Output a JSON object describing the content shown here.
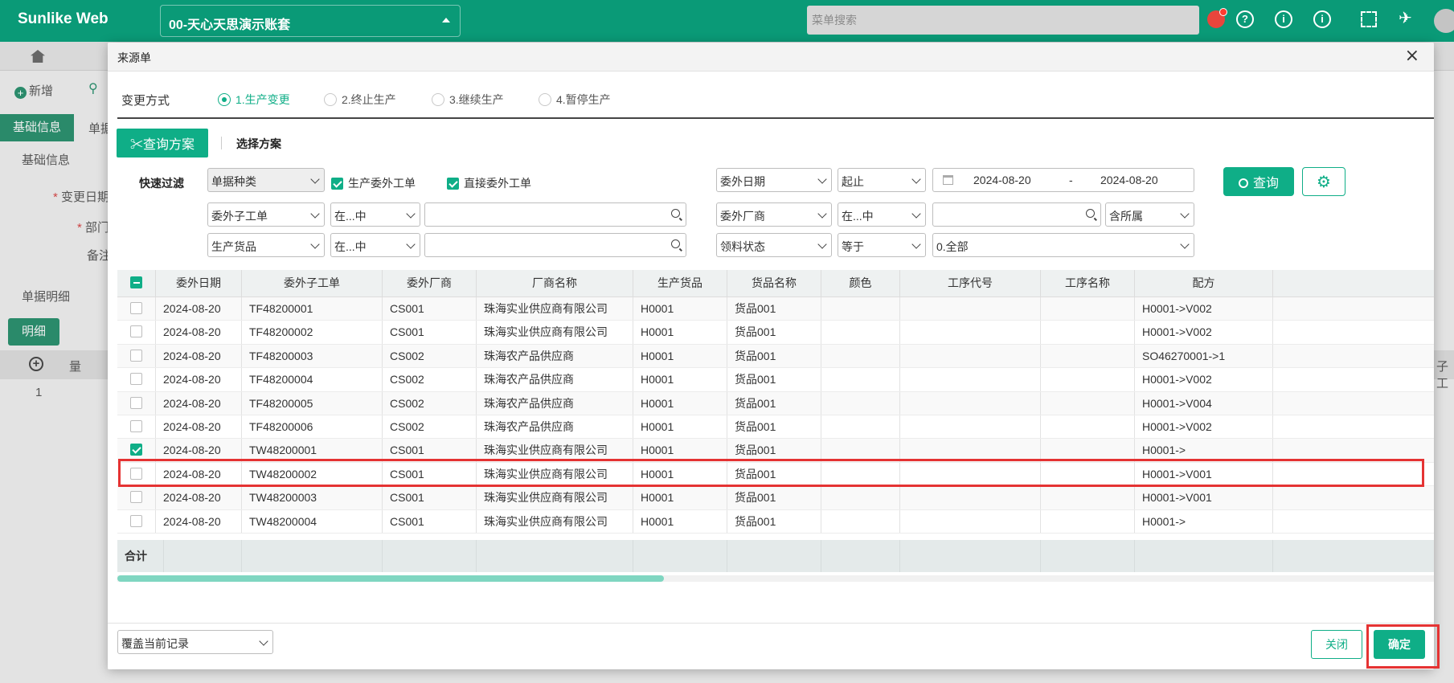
{
  "app": {
    "brand": "Sunlike Web",
    "account": "00-天心天思演示账套",
    "menu_search_placeholder": "菜单搜索"
  },
  "background": {
    "toolbar_new": "新增",
    "tab_basic": "基础信息",
    "tab_doc": "单据",
    "section_basic": "基础信息",
    "field_change_date": "变更日期",
    "field_dept": "部门",
    "field_note": "备注",
    "section_detail": "单据明细",
    "btn_detail": "明细",
    "col_qty": "量",
    "row_no": "1",
    "col_partial": "子工"
  },
  "modal": {
    "title": "来源单",
    "change_label": "变更方式",
    "radios": [
      {
        "label": "1.生产变更",
        "selected": true
      },
      {
        "label": "2.终止生产",
        "selected": false
      },
      {
        "label": "3.继续生产",
        "selected": false
      },
      {
        "label": "4.暂停生产",
        "selected": false
      }
    ],
    "scheme_button": "查询方案",
    "select_scheme": "选择方案",
    "quick_filter": "快速过滤",
    "filters": {
      "doc_type": "单据种类",
      "cb_prod_sub": "生产委外工单",
      "cb_direct_sub": "直接委外工单",
      "sub_date": "委外日期",
      "date_mode": "起止",
      "date_from": "2024-08-20",
      "date_sep": "-",
      "date_to": "2024-08-20",
      "sub_order": "委外子工单",
      "op_in1": "在...中",
      "vendor": "委外厂商",
      "op_in2": "在...中",
      "include_sub": "含所属",
      "prod_goods": "生产货品",
      "op_in3": "在...中",
      "material_status": "领料状态",
      "op_eq": "等于",
      "status_value": "0.全部"
    },
    "query_button": "查询",
    "table": {
      "columns": [
        "委外日期",
        "委外子工单",
        "委外厂商",
        "厂商名称",
        "生产货品",
        "货品名称",
        "颜色",
        "工序代号",
        "工序名称",
        "配方"
      ],
      "rows": [
        {
          "checked": false,
          "date": "2024-08-20",
          "order": "TF48200001",
          "vendor": "CS001",
          "vendor_name": "珠海实业供应商有限公司",
          "goods": "H0001",
          "goods_name": "货品001",
          "color": "",
          "op_code": "",
          "op_name": "",
          "formula": "H0001->V002"
        },
        {
          "checked": false,
          "date": "2024-08-20",
          "order": "TF48200002",
          "vendor": "CS001",
          "vendor_name": "珠海实业供应商有限公司",
          "goods": "H0001",
          "goods_name": "货品001",
          "color": "",
          "op_code": "",
          "op_name": "",
          "formula": "H0001->V002"
        },
        {
          "checked": false,
          "date": "2024-08-20",
          "order": "TF48200003",
          "vendor": "CS002",
          "vendor_name": "珠海农产品供应商",
          "goods": "H0001",
          "goods_name": "货品001",
          "color": "",
          "op_code": "",
          "op_name": "",
          "formula": "SO46270001->1"
        },
        {
          "checked": false,
          "date": "2024-08-20",
          "order": "TF48200004",
          "vendor": "CS002",
          "vendor_name": "珠海农产品供应商",
          "goods": "H0001",
          "goods_name": "货品001",
          "color": "",
          "op_code": "",
          "op_name": "",
          "formula": "H0001->V002"
        },
        {
          "checked": false,
          "date": "2024-08-20",
          "order": "TF48200005",
          "vendor": "CS002",
          "vendor_name": "珠海农产品供应商",
          "goods": "H0001",
          "goods_name": "货品001",
          "color": "",
          "op_code": "",
          "op_name": "",
          "formula": "H0001->V004"
        },
        {
          "checked": false,
          "date": "2024-08-20",
          "order": "TF48200006",
          "vendor": "CS002",
          "vendor_name": "珠海农产品供应商",
          "goods": "H0001",
          "goods_name": "货品001",
          "color": "",
          "op_code": "",
          "op_name": "",
          "formula": "H0001->V002"
        },
        {
          "checked": true,
          "date": "2024-08-20",
          "order": "TW48200001",
          "vendor": "CS001",
          "vendor_name": "珠海实业供应商有限公司",
          "goods": "H0001",
          "goods_name": "货品001",
          "color": "",
          "op_code": "",
          "op_name": "",
          "formula": "H0001->"
        },
        {
          "checked": false,
          "date": "2024-08-20",
          "order": "TW48200002",
          "vendor": "CS001",
          "vendor_name": "珠海实业供应商有限公司",
          "goods": "H0001",
          "goods_name": "货品001",
          "color": "",
          "op_code": "",
          "op_name": "",
          "formula": "H0001->V001"
        },
        {
          "checked": false,
          "date": "2024-08-20",
          "order": "TW48200003",
          "vendor": "CS001",
          "vendor_name": "珠海实业供应商有限公司",
          "goods": "H0001",
          "goods_name": "货品001",
          "color": "",
          "op_code": "",
          "op_name": "",
          "formula": "H0001->V001"
        },
        {
          "checked": false,
          "date": "2024-08-20",
          "order": "TW48200004",
          "vendor": "CS001",
          "vendor_name": "珠海实业供应商有限公司",
          "goods": "H0001",
          "goods_name": "货品001",
          "color": "",
          "op_code": "",
          "op_name": "",
          "formula": "H0001->"
        }
      ],
      "footer_label": "合计"
    },
    "mode_select": "覆盖当前记录",
    "close_button": "关闭",
    "ok_button": "确定"
  },
  "colors": {
    "brand_green": "#0a9a77",
    "accent": "#0fae87",
    "highlight_red": "#e53333"
  }
}
